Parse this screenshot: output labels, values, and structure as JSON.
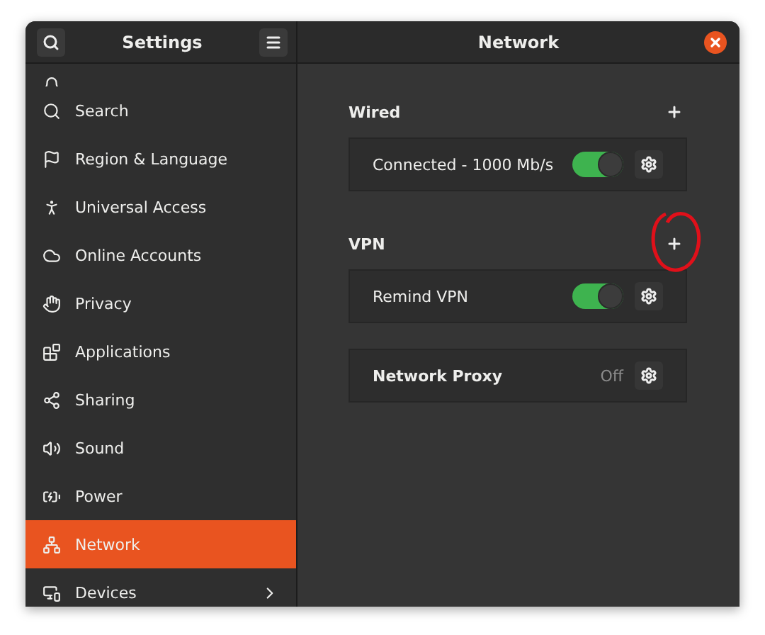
{
  "sidebar": {
    "title": "Settings",
    "items": [
      {
        "label": "Search",
        "selected": false
      },
      {
        "label": "Region & Language",
        "selected": false
      },
      {
        "label": "Universal Access",
        "selected": false
      },
      {
        "label": "Online Accounts",
        "selected": false
      },
      {
        "label": "Privacy",
        "selected": false
      },
      {
        "label": "Applications",
        "selected": false
      },
      {
        "label": "Sharing",
        "selected": false
      },
      {
        "label": "Sound",
        "selected": false
      },
      {
        "label": "Power",
        "selected": false
      },
      {
        "label": "Network",
        "selected": true
      },
      {
        "label": "Devices",
        "selected": false,
        "has_submenu": true
      }
    ]
  },
  "panel": {
    "title": "Network",
    "sections": [
      {
        "kind": "section",
        "heading": "Wired",
        "rows": [
          {
            "label": "Connected - 1000 Mb/s",
            "on": true
          }
        ]
      },
      {
        "kind": "section",
        "heading": "VPN",
        "annotated": true,
        "rows": [
          {
            "label": "Remind VPN",
            "on": true
          }
        ]
      },
      {
        "kind": "proxy",
        "label": "Network Proxy",
        "status": "Off"
      }
    ]
  }
}
